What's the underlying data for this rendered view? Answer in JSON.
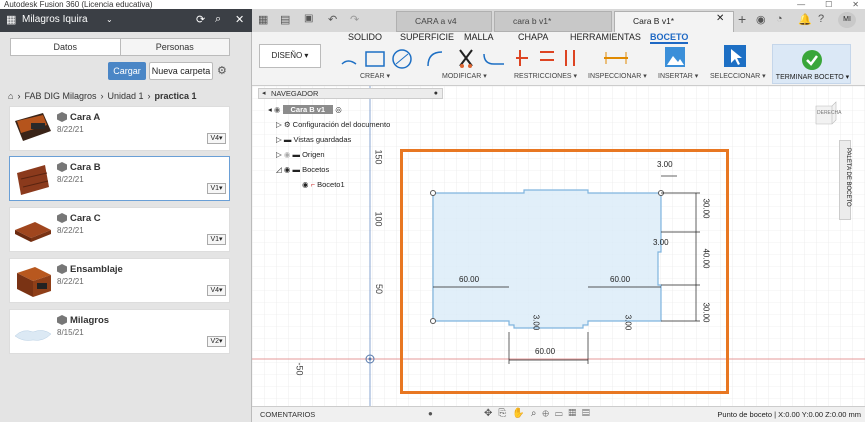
{
  "window": {
    "title": "Autodesk Fusion 360 (Licencia educativa)"
  },
  "data_panel": {
    "project_name": "Milagros Iquira",
    "tabs": [
      "Datos",
      "Personas"
    ],
    "upload_label": "Cargar",
    "new_folder_label": "Nueva carpeta",
    "breadcrumb": [
      "FAB DIG Milagros",
      "Unidad 1",
      "practica 1"
    ],
    "files": [
      {
        "name": "Cara A",
        "date": "8/22/21",
        "version": "V4▾",
        "thumb": "cara-a"
      },
      {
        "name": "Cara B",
        "date": "8/22/21",
        "version": "V1▾",
        "thumb": "cara-b"
      },
      {
        "name": "Cara C",
        "date": "8/22/21",
        "version": "V1▾",
        "thumb": "cara-c"
      },
      {
        "name": "Ensamblaje",
        "date": "8/22/21",
        "version": "V4▾",
        "thumb": "ensamblaje"
      },
      {
        "name": "Milagros",
        "date": "8/15/21",
        "version": "V2▾",
        "thumb": "milagros"
      }
    ]
  },
  "doc_tabs": [
    "CARA  a v4",
    "cara b v1*",
    "Cara B v1*"
  ],
  "avatar_initials": "MI",
  "ribbon": {
    "tabs": [
      "SOLIDO",
      "SUPERFICIE",
      "MALLA",
      "CHAPA",
      "HERRAMIENTAS",
      "BOCETO"
    ],
    "workspace": "DISEÑO ▾",
    "groups": [
      "CREAR ▾",
      "MODIFICAR ▾",
      "RESTRICCIONES ▾",
      "INSPECCIONAR ▾",
      "INSERTAR ▾",
      "SELECCIONAR ▾"
    ],
    "finish": "TERMINAR BOCETO ▾"
  },
  "navigator": {
    "title": "NAVEGADOR",
    "root": "Cara B v1",
    "items": [
      "Configuración del documento",
      "Vistas guardadas",
      "Origen",
      "Bocetos",
      "Boceto1"
    ]
  },
  "axis_labels": [
    "150",
    "100",
    "50",
    "-50"
  ],
  "dimensions": {
    "top": "3.00",
    "right_top": "30.00",
    "right_mid": "40.00",
    "right_bottom": "30.00",
    "inner": "3.00",
    "left_w": "60.00",
    "right_w": "60.00",
    "slot_left": "3.00",
    "slot_right": "3.00",
    "bottom": "60.00"
  },
  "viewcube_label": "DERECHA",
  "sketch_palette": "PALETA DE BOCETO",
  "comments": "COMENTARIOS",
  "status": "Punto de boceto | X:0.00 Y:0.00 Z:0.00 mm"
}
